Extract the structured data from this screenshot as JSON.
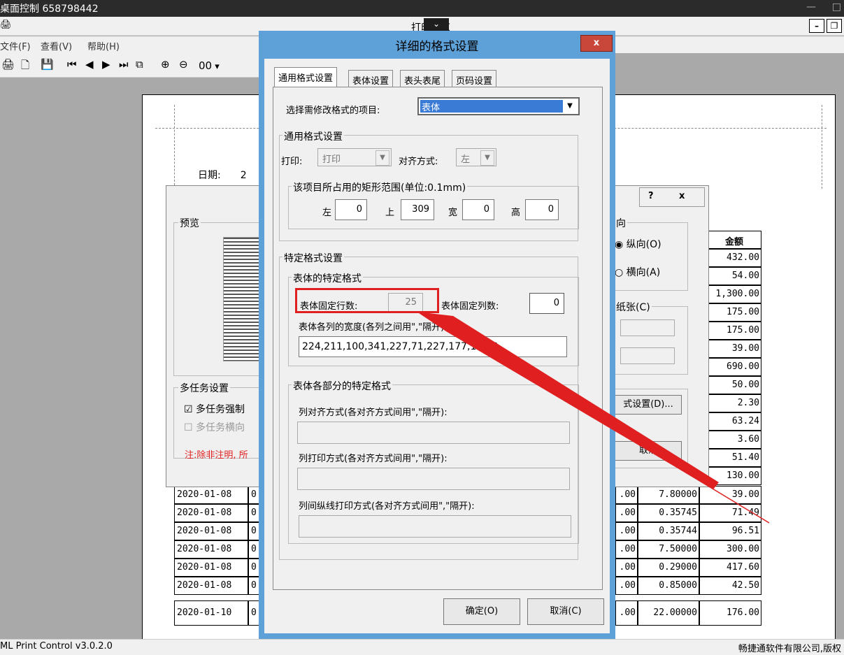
{
  "remote_title": "桌面控制 658798442",
  "app": {
    "title": "打印预览",
    "menu": [
      "文件(F)",
      "查看(V)",
      "帮助(H)"
    ],
    "zoom_label": "00",
    "status_left": "ML Print Control v3.0.2.0",
    "status_right": "畅捷通软件有限公司,版权"
  },
  "page": {
    "date_label": "日期:",
    "date_value_partial": "2",
    "table_header": "金额",
    "amounts": [
      "432.00",
      "54.00",
      "1,300.00",
      "175.00",
      "175.00",
      "39.00",
      "690.00",
      "50.00",
      "2.30",
      "63.24",
      "3.60",
      "51.40",
      "130.00"
    ],
    "rows": [
      {
        "date": "2020-01-08",
        "c2": "0",
        "c3": ".00",
        "price": "7.80000",
        "amount": "39.00"
      },
      {
        "date": "2020-01-08",
        "c2": "0",
        "c3": ".00",
        "price": "0.35745",
        "amount": "71.49"
      },
      {
        "date": "2020-01-08",
        "c2": "0",
        "c3": ".00",
        "price": "0.35744",
        "amount": "96.51"
      },
      {
        "date": "2020-01-08",
        "c2": "0",
        "c3": ".00",
        "price": "7.50000",
        "amount": "300.00"
      },
      {
        "date": "2020-01-08",
        "c2": "0",
        "c3": ".00",
        "price": "0.29000",
        "amount": "417.60"
      },
      {
        "date": "2020-01-08",
        "c2": "0",
        "c3": ".00",
        "price": "0.85000",
        "amount": "42.50"
      },
      {
        "date": "2020-01-10",
        "c2": "0",
        "c3": ".00",
        "price": "22.00000",
        "amount": "176.00"
      }
    ]
  },
  "bg_dialog": {
    "help": "?",
    "close": "x",
    "preview_group": "预览",
    "orientation_group": "向",
    "portrait": "纵向(O)",
    "landscape": "横向(A)",
    "paper_group": "纸张(C)",
    "multitask_group": "多任务设置",
    "multitask_force": "多任务强制",
    "multitask_landscape": "多任务横向",
    "note": "注:除非注明, 所",
    "format_btn": "式设置(D)...",
    "cancel_btn": "取消"
  },
  "dialog": {
    "title": "详细的格式设置",
    "close": "x",
    "tabs": [
      "通用格式设置",
      "表体设置",
      "表头表尾",
      "页码设置"
    ],
    "select_label": "选择需修改格式的项目:",
    "select_value": "表体",
    "general_group": "通用格式设置",
    "print_label": "打印:",
    "print_value": "打印",
    "align_label": "对齐方式:",
    "align_value": "左",
    "rect_group": "该项目所占用的矩形范围(单位:0.1mm)",
    "left_label": "左",
    "left_value": "0",
    "top_label": "上",
    "top_value": "309",
    "width_label": "宽",
    "width_value": "0",
    "height_label": "高",
    "height_value": "0",
    "special_group": "特定格式设置",
    "body_group": "表体的特定格式",
    "fixed_rows_label": "表体固定行数:",
    "fixed_rows_value": "25",
    "fixed_cols_label": "表体固定列数:",
    "fixed_cols_value": "0",
    "col_width_label": "表体各列的宽度(各列之间用\",\"隔开)",
    "col_width_value": "224,211,100,341,227,71,227,177,198,2",
    "parts_group": "表体各部分的特定格式",
    "col_align_label": "列对齐方式(各对齐方式间用\",\"隔开):",
    "col_print_label": "列打印方式(各对齐方式间用\",\"隔开):",
    "col_line_label": "列间纵线打印方式(各对齐方式间用\",\"隔开):",
    "ok": "确定(O)",
    "cancel": "取消(C)"
  },
  "colors": {
    "accent_border": "#5ea0d8",
    "highlight": "#e02020",
    "close": "#c8463a"
  }
}
